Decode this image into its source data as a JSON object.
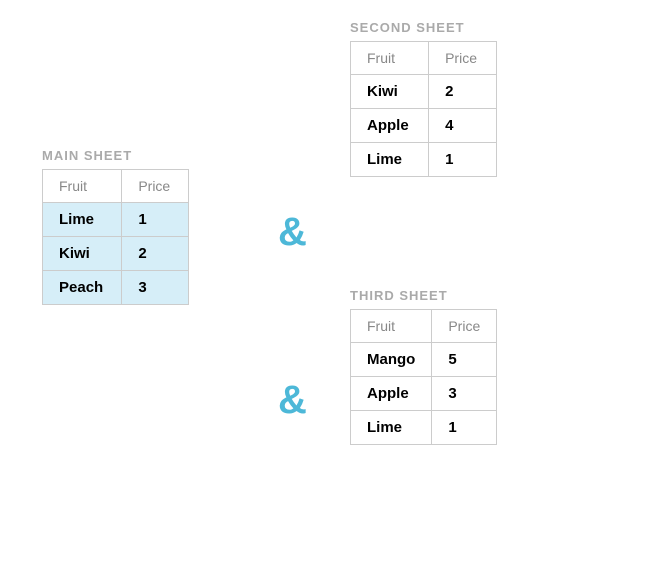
{
  "main_sheet": {
    "label": "MAIN SHEET",
    "headers": [
      "Fruit",
      "Price"
    ],
    "rows": [
      {
        "fruit": "Lime",
        "price": "1",
        "highlight": true
      },
      {
        "fruit": "Kiwi",
        "price": "2",
        "highlight": true
      },
      {
        "fruit": "Peach",
        "price": "3",
        "highlight": true
      }
    ]
  },
  "second_sheet": {
    "label": "SECOND SHEET",
    "headers": [
      "Fruit",
      "Price"
    ],
    "rows": [
      {
        "fruit": "Kiwi",
        "price": "2",
        "highlight": false
      },
      {
        "fruit": "Apple",
        "price": "4",
        "highlight": false
      },
      {
        "fruit": "Lime",
        "price": "1",
        "highlight": false
      }
    ]
  },
  "third_sheet": {
    "label": "THIRD SHEET",
    "headers": [
      "Fruit",
      "Price"
    ],
    "rows": [
      {
        "fruit": "Mango",
        "price": "5",
        "highlight": false
      },
      {
        "fruit": "Apple",
        "price": "3",
        "highlight": false
      },
      {
        "fruit": "Lime",
        "price": "1",
        "highlight": false
      }
    ]
  },
  "amp1": "&",
  "amp2": "&"
}
